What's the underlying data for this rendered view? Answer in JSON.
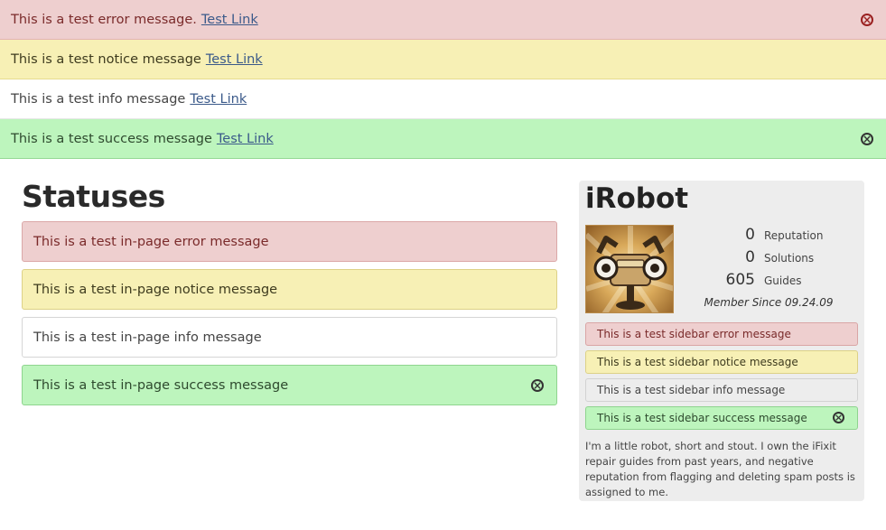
{
  "banners": {
    "error": {
      "text": "This is a test error message.",
      "link": "Test Link"
    },
    "notice": {
      "text": "This is a test notice message",
      "link": "Test Link"
    },
    "info": {
      "text": "This is a test info message",
      "link": "Test Link"
    },
    "success": {
      "text": "This is a test success message",
      "link": "Test Link"
    }
  },
  "main": {
    "title": "Statuses",
    "messages": {
      "error": "This is a test in-page error message",
      "notice": "This is a test in-page notice message",
      "info": "This is a test in-page info message",
      "success": "This is a test in-page success message"
    }
  },
  "sidebar": {
    "name": "iRobot",
    "stats": [
      {
        "value": "0",
        "label": "Reputation"
      },
      {
        "value": "0",
        "label": "Solutions"
      },
      {
        "value": "605",
        "label": "Guides"
      }
    ],
    "member_since": "Member Since 09.24.09",
    "messages": {
      "error": "This is a test sidebar error message",
      "notice": "This is a test sidebar notice message",
      "info": "This is a test sidebar info message",
      "success": "This is a test sidebar success message"
    },
    "bio": "I'm a little robot, short and stout. I own the iFixit repair guides from past years, and negative reputation from flagging and deleting spam posts is assigned to me."
  },
  "colors": {
    "error_bg": "#eecfcf",
    "notice_bg": "#f7f0b5",
    "info_bg": "#ffffff",
    "success_bg": "#bdf5bd",
    "link": "#3b5a8a"
  }
}
